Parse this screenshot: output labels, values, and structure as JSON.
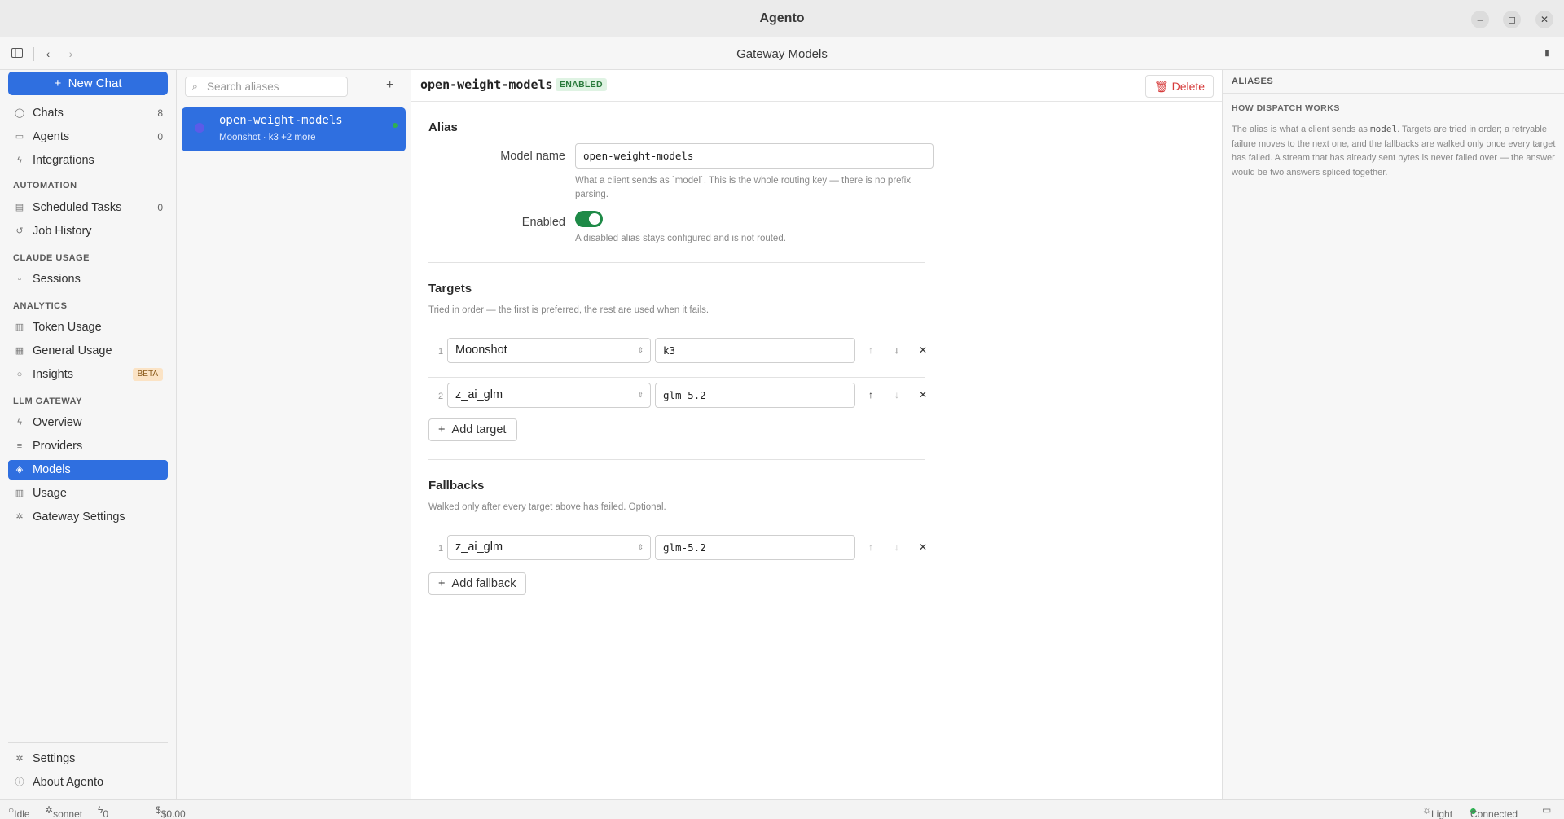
{
  "app": {
    "title": "Agento",
    "view_title": "Gateway Models"
  },
  "window_controls": {
    "minimize": "–",
    "maximize": "◻",
    "close": "✕"
  },
  "sidebar": {
    "new_chat": "New Chat",
    "top_items": [
      {
        "label": "Chats",
        "count": "8",
        "icon": "chat-icon"
      },
      {
        "label": "Agents",
        "count": "0",
        "icon": "agent-icon"
      },
      {
        "label": "Integrations",
        "count": "",
        "icon": "plug-icon"
      }
    ],
    "automation": {
      "heading": "AUTOMATION",
      "items": [
        {
          "label": "Scheduled Tasks",
          "count": "0"
        },
        {
          "label": "Job History",
          "count": ""
        }
      ]
    },
    "claude_usage": {
      "heading": "CLAUDE USAGE",
      "items": [
        {
          "label": "Sessions"
        }
      ]
    },
    "analytics": {
      "heading": "ANALYTICS",
      "items": [
        {
          "label": "Token Usage"
        },
        {
          "label": "General Usage"
        },
        {
          "label": "Insights",
          "badge": "BETA"
        }
      ]
    },
    "llm_gateway": {
      "heading": "LLM GATEWAY",
      "items": [
        {
          "label": "Overview"
        },
        {
          "label": "Providers"
        },
        {
          "label": "Models",
          "active": true
        },
        {
          "label": "Usage"
        },
        {
          "label": "Gateway Settings"
        }
      ]
    },
    "bottom_items": [
      {
        "label": "Settings"
      },
      {
        "label": "About Agento"
      }
    ]
  },
  "aliases": {
    "search_placeholder": "Search aliases",
    "items": [
      {
        "name": "open-weight-models",
        "subtitle": "Moonshot · k3 +2 more",
        "active": true
      }
    ]
  },
  "editor": {
    "alias_name": "open-weight-models",
    "status_badge": "ENABLED",
    "delete_label": "Delete",
    "alias_section": "Alias",
    "model_name_label": "Model name",
    "model_name_value": "open-weight-models",
    "model_name_hint": "What a client sends as `model`. This is the whole routing key — there is no prefix parsing.",
    "enabled_label": "Enabled",
    "enabled": true,
    "enabled_hint": "A disabled alias stays configured and is not routed.",
    "targets_section": "Targets",
    "targets_hint": "Tried in order — the first is preferred, the rest are used when it fails.",
    "targets": [
      {
        "index": "1",
        "provider": "Moonshot",
        "model": "k3"
      },
      {
        "index": "2",
        "provider": "z_ai_glm",
        "model": "glm-5.2"
      }
    ],
    "add_target": "Add target",
    "fallbacks_section": "Fallbacks",
    "fallbacks_hint": "Walked only after every target above has failed. Optional.",
    "fallbacks": [
      {
        "index": "1",
        "provider": "z_ai_glm",
        "model": "glm-5.2"
      }
    ],
    "add_fallback": "Add fallback"
  },
  "info_panel": {
    "heading": "ALIASES",
    "subheading": "HOW DISPATCH WORKS",
    "text_before": "The alias is what a client sends as ",
    "code": "model",
    "text_after": ". Targets are tried in order; a retryable failure moves to the next one, and the fallbacks are walked only once every target has failed. A stream that has already sent bytes is never failed over — the answer would be two answers spliced together."
  },
  "status_bar": {
    "state": "Idle",
    "model": "sonnet",
    "today": "0  today",
    "cost": "$0.00",
    "theme": "Light",
    "connection": "Connected"
  },
  "colors": {
    "accent": "#2f6fe0",
    "enabled_green": "#1e8a47",
    "delete_red": "#d63b3b"
  }
}
